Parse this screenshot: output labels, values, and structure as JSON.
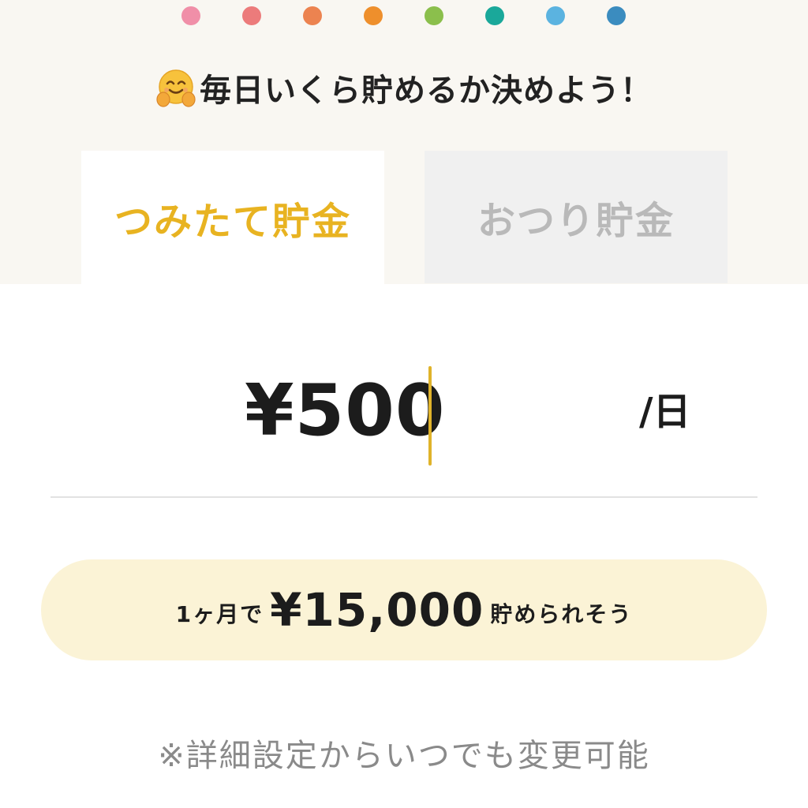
{
  "progress_dots": {
    "colors": [
      "#f08fa8",
      "#ec7b7b",
      "#ec8350",
      "#ee8f2c",
      "#8bbf4c",
      "#1aa89a",
      "#5bb3e0",
      "#3b8cbf"
    ]
  },
  "heading": {
    "emoji": "hugging-face-emoji",
    "text": "毎日いくら貯めるか決めよう！"
  },
  "tabs": [
    {
      "label": "つみたて貯金",
      "active": true,
      "color": "#e8b321"
    },
    {
      "label": "おつり貯金",
      "active": false,
      "color": "#b9b9b9"
    }
  ],
  "amount": {
    "value": "¥500",
    "unit": "/日",
    "caret_color": "#e0b32a"
  },
  "summary": {
    "prefix": "1ヶ月で",
    "amount": "¥15,000",
    "suffix": "貯められそう"
  },
  "note": "※詳細設定からいつでも変更可能"
}
